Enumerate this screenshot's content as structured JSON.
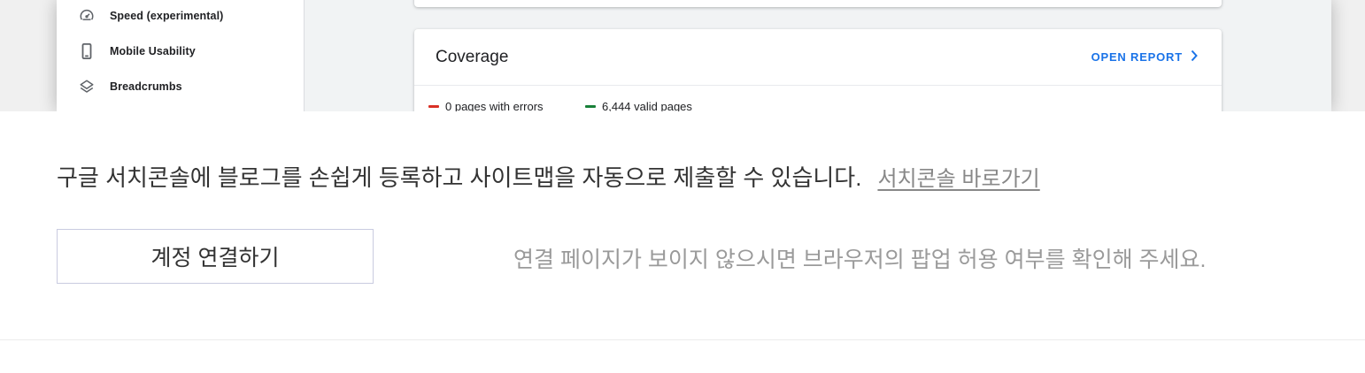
{
  "preview": {
    "sidebar": {
      "items": [
        {
          "icon": "speed-gauge-icon",
          "label": "Speed (experimental)"
        },
        {
          "icon": "mobile-phone-icon",
          "label": "Mobile Usability"
        },
        {
          "icon": "layers-icon",
          "label": "Breadcrumbs"
        }
      ]
    },
    "coverage_card": {
      "title": "Coverage",
      "open_report_label": "OPEN REPORT",
      "legend": [
        {
          "label": "0 pages with errors",
          "color": "#d93025"
        },
        {
          "label": "6,444 valid pages",
          "color": "#188038"
        }
      ]
    }
  },
  "panel": {
    "info_text": "구글 서치콘솔에 블로그를 손쉽게 등록하고 사이트맵을 자동으로 제출할 수 있습니다.",
    "search_console_link": "서치콘솔 바로가기",
    "connect_button_label": "계정 연결하기",
    "popup_hint": "연결 페이지가 보이지 않으시면 브라우저의 팝업 허용 여부를 확인해 주세요."
  },
  "colors": {
    "accent_link": "#1a73e8",
    "error": "#d93025",
    "valid": "#188038"
  }
}
